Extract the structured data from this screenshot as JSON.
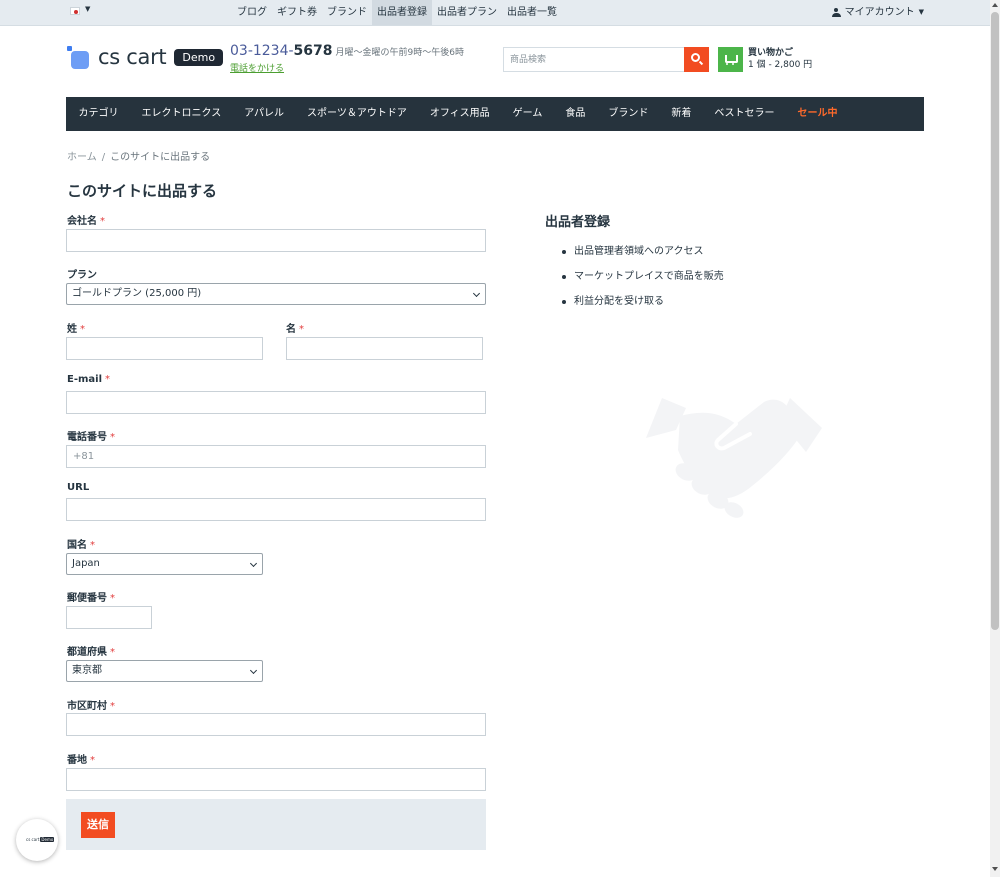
{
  "topbar": {
    "nav": [
      "ブログ",
      "ギフト券",
      "ブランド",
      "出品者登録",
      "出品者プラン",
      "出品者一覧"
    ],
    "active_index": 3,
    "account_label": "マイアカウント"
  },
  "header": {
    "logo_text": "cs cart",
    "logo_badge": "Demo",
    "phone_prefix": "03-1234-",
    "phone_suffix": "5678",
    "hours": "月曜〜金曜の午前9時〜午後6時",
    "call_link": "電話をかける",
    "search_placeholder": "商品検索",
    "cart_title": "買い物かご",
    "cart_summary": "1 個 - 2,800 円"
  },
  "mainnav": {
    "items": [
      "カテゴリ",
      "エレクトロニクス",
      "アパレル",
      "スポーツ＆アウトドア",
      "オフィス用品",
      "ゲーム",
      "食品",
      "ブランド",
      "新着",
      "ベストセラー",
      "セール中"
    ]
  },
  "breadcrumb": {
    "home": "ホーム",
    "sep": "/",
    "current": "このサイトに出品する"
  },
  "page_title": "このサイトに出品する",
  "form": {
    "company_label": "会社名",
    "plan_label": "プラン",
    "plan_value": "ゴールドプラン (25,000 円)",
    "lastname_label": "姓",
    "firstname_label": "名",
    "email_label": "E-mail",
    "phone_label": "電話番号",
    "phone_placeholder": "+81",
    "url_label": "URL",
    "country_label": "国名",
    "country_value": "Japan",
    "zip_label": "郵便番号",
    "state_label": "都道府県",
    "state_value": "東京都",
    "city_label": "市区町村",
    "address_label": "番地",
    "required_mark": "*",
    "submit_label": "送信"
  },
  "info": {
    "title": "出品者登録",
    "items": [
      "出品管理者領域へのアクセス",
      "マーケットプレイスで商品を販売",
      "利益分配を受け取る"
    ]
  },
  "widget": {
    "logo_text": "cs cart",
    "badge": "Demo"
  },
  "colors": {
    "accent": "#f24c21",
    "cart": "#4cb54a",
    "nav_bg": "#26333d",
    "sale": "#ff6a2b",
    "topbar_bg": "#e5ebf0"
  }
}
